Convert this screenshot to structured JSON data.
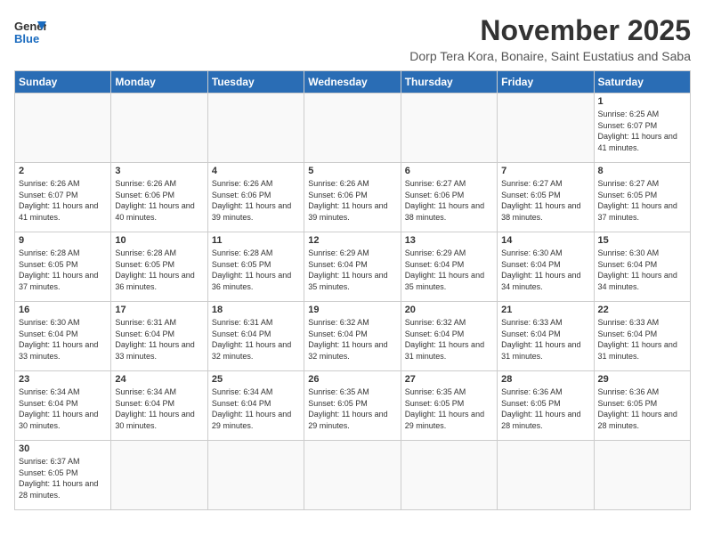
{
  "logo": {
    "line1": "General",
    "line2": "Blue"
  },
  "title": "November 2025",
  "subtitle": "Dorp Tera Kora, Bonaire, Saint Eustatius and Saba",
  "weekdays": [
    "Sunday",
    "Monday",
    "Tuesday",
    "Wednesday",
    "Thursday",
    "Friday",
    "Saturday"
  ],
  "weeks": [
    [
      {
        "day": "",
        "info": ""
      },
      {
        "day": "",
        "info": ""
      },
      {
        "day": "",
        "info": ""
      },
      {
        "day": "",
        "info": ""
      },
      {
        "day": "",
        "info": ""
      },
      {
        "day": "",
        "info": ""
      },
      {
        "day": "1",
        "info": "Sunrise: 6:25 AM\nSunset: 6:07 PM\nDaylight: 11 hours and 41 minutes."
      }
    ],
    [
      {
        "day": "2",
        "info": "Sunrise: 6:26 AM\nSunset: 6:07 PM\nDaylight: 11 hours and 41 minutes."
      },
      {
        "day": "3",
        "info": "Sunrise: 6:26 AM\nSunset: 6:06 PM\nDaylight: 11 hours and 40 minutes."
      },
      {
        "day": "4",
        "info": "Sunrise: 6:26 AM\nSunset: 6:06 PM\nDaylight: 11 hours and 39 minutes."
      },
      {
        "day": "5",
        "info": "Sunrise: 6:26 AM\nSunset: 6:06 PM\nDaylight: 11 hours and 39 minutes."
      },
      {
        "day": "6",
        "info": "Sunrise: 6:27 AM\nSunset: 6:06 PM\nDaylight: 11 hours and 38 minutes."
      },
      {
        "day": "7",
        "info": "Sunrise: 6:27 AM\nSunset: 6:05 PM\nDaylight: 11 hours and 38 minutes."
      },
      {
        "day": "8",
        "info": "Sunrise: 6:27 AM\nSunset: 6:05 PM\nDaylight: 11 hours and 37 minutes."
      }
    ],
    [
      {
        "day": "9",
        "info": "Sunrise: 6:28 AM\nSunset: 6:05 PM\nDaylight: 11 hours and 37 minutes."
      },
      {
        "day": "10",
        "info": "Sunrise: 6:28 AM\nSunset: 6:05 PM\nDaylight: 11 hours and 36 minutes."
      },
      {
        "day": "11",
        "info": "Sunrise: 6:28 AM\nSunset: 6:05 PM\nDaylight: 11 hours and 36 minutes."
      },
      {
        "day": "12",
        "info": "Sunrise: 6:29 AM\nSunset: 6:04 PM\nDaylight: 11 hours and 35 minutes."
      },
      {
        "day": "13",
        "info": "Sunrise: 6:29 AM\nSunset: 6:04 PM\nDaylight: 11 hours and 35 minutes."
      },
      {
        "day": "14",
        "info": "Sunrise: 6:30 AM\nSunset: 6:04 PM\nDaylight: 11 hours and 34 minutes."
      },
      {
        "day": "15",
        "info": "Sunrise: 6:30 AM\nSunset: 6:04 PM\nDaylight: 11 hours and 34 minutes."
      }
    ],
    [
      {
        "day": "16",
        "info": "Sunrise: 6:30 AM\nSunset: 6:04 PM\nDaylight: 11 hours and 33 minutes."
      },
      {
        "day": "17",
        "info": "Sunrise: 6:31 AM\nSunset: 6:04 PM\nDaylight: 11 hours and 33 minutes."
      },
      {
        "day": "18",
        "info": "Sunrise: 6:31 AM\nSunset: 6:04 PM\nDaylight: 11 hours and 32 minutes."
      },
      {
        "day": "19",
        "info": "Sunrise: 6:32 AM\nSunset: 6:04 PM\nDaylight: 11 hours and 32 minutes."
      },
      {
        "day": "20",
        "info": "Sunrise: 6:32 AM\nSunset: 6:04 PM\nDaylight: 11 hours and 31 minutes."
      },
      {
        "day": "21",
        "info": "Sunrise: 6:33 AM\nSunset: 6:04 PM\nDaylight: 11 hours and 31 minutes."
      },
      {
        "day": "22",
        "info": "Sunrise: 6:33 AM\nSunset: 6:04 PM\nDaylight: 11 hours and 31 minutes."
      }
    ],
    [
      {
        "day": "23",
        "info": "Sunrise: 6:34 AM\nSunset: 6:04 PM\nDaylight: 11 hours and 30 minutes."
      },
      {
        "day": "24",
        "info": "Sunrise: 6:34 AM\nSunset: 6:04 PM\nDaylight: 11 hours and 30 minutes."
      },
      {
        "day": "25",
        "info": "Sunrise: 6:34 AM\nSunset: 6:04 PM\nDaylight: 11 hours and 29 minutes."
      },
      {
        "day": "26",
        "info": "Sunrise: 6:35 AM\nSunset: 6:05 PM\nDaylight: 11 hours and 29 minutes."
      },
      {
        "day": "27",
        "info": "Sunrise: 6:35 AM\nSunset: 6:05 PM\nDaylight: 11 hours and 29 minutes."
      },
      {
        "day": "28",
        "info": "Sunrise: 6:36 AM\nSunset: 6:05 PM\nDaylight: 11 hours and 28 minutes."
      },
      {
        "day": "29",
        "info": "Sunrise: 6:36 AM\nSunset: 6:05 PM\nDaylight: 11 hours and 28 minutes."
      }
    ],
    [
      {
        "day": "30",
        "info": "Sunrise: 6:37 AM\nSunset: 6:05 PM\nDaylight: 11 hours and 28 minutes."
      },
      {
        "day": "",
        "info": ""
      },
      {
        "day": "",
        "info": ""
      },
      {
        "day": "",
        "info": ""
      },
      {
        "day": "",
        "info": ""
      },
      {
        "day": "",
        "info": ""
      },
      {
        "day": "",
        "info": ""
      }
    ]
  ]
}
